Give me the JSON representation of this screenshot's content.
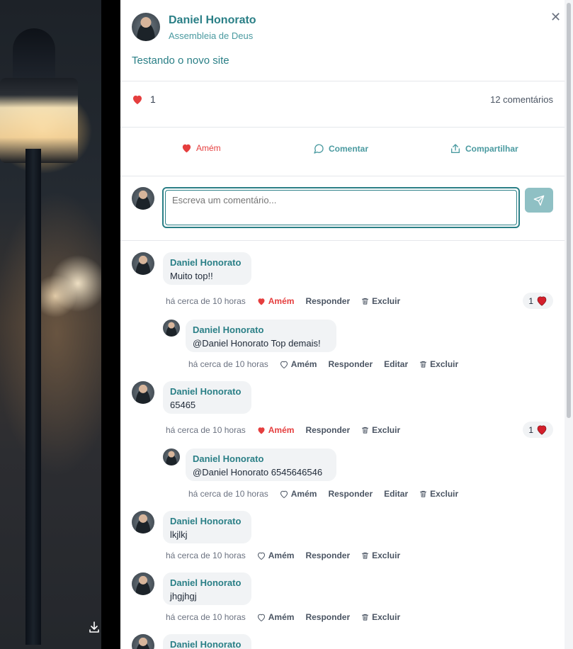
{
  "post": {
    "author": "Daniel Honorato",
    "church": "Assembleia de Deus",
    "text": "Testando o novo site",
    "like_count": "1",
    "comment_count": "12 comentários"
  },
  "actions": {
    "amen": "Amém",
    "comment": "Comentar",
    "share": "Compartilhar"
  },
  "compose": {
    "placeholder": "Escreva um comentário..."
  },
  "colors": {
    "accent": "#2a7f86",
    "heart": "#e53e3e",
    "send": "#8fc0c4"
  },
  "comments": [
    {
      "author": "Daniel Honorato",
      "text": "Muito top!!",
      "time": "há cerca de 10 horas",
      "amen": "Amém",
      "reply": "Responder",
      "delete": "Excluir",
      "reactions": "1",
      "liked": true,
      "replies": [
        {
          "author": "Daniel Honorato",
          "text": "@Daniel Honorato Top demais!",
          "time": "há cerca de 10 horas",
          "amen": "Amém",
          "reply": "Responder",
          "edit": "Editar",
          "delete": "Excluir"
        }
      ]
    },
    {
      "author": "Daniel Honorato",
      "text": "65465",
      "time": "há cerca de 10 horas",
      "amen": "Amém",
      "reply": "Responder",
      "delete": "Excluir",
      "reactions": "1",
      "liked": true,
      "replies": [
        {
          "author": "Daniel Honorato",
          "text": "@Daniel Honorato 6545646546",
          "time": "há cerca de 10 horas",
          "amen": "Amém",
          "reply": "Responder",
          "edit": "Editar",
          "delete": "Excluir"
        }
      ]
    },
    {
      "author": "Daniel Honorato",
      "text": "lkjlkj",
      "time": "há cerca de 10 horas",
      "amen": "Amém",
      "reply": "Responder",
      "delete": "Excluir",
      "liked": false
    },
    {
      "author": "Daniel Honorato",
      "text": "jhgjhgj",
      "time": "há cerca de 10 horas",
      "amen": "Amém",
      "reply": "Responder",
      "delete": "Excluir",
      "liked": false
    },
    {
      "author": "Daniel Honorato"
    }
  ],
  "icons": {
    "close": "close-icon",
    "heart": "heart-icon",
    "comment": "comment-icon",
    "share": "share-icon",
    "send": "send-icon",
    "trash": "trash-icon",
    "download": "download-icon"
  }
}
